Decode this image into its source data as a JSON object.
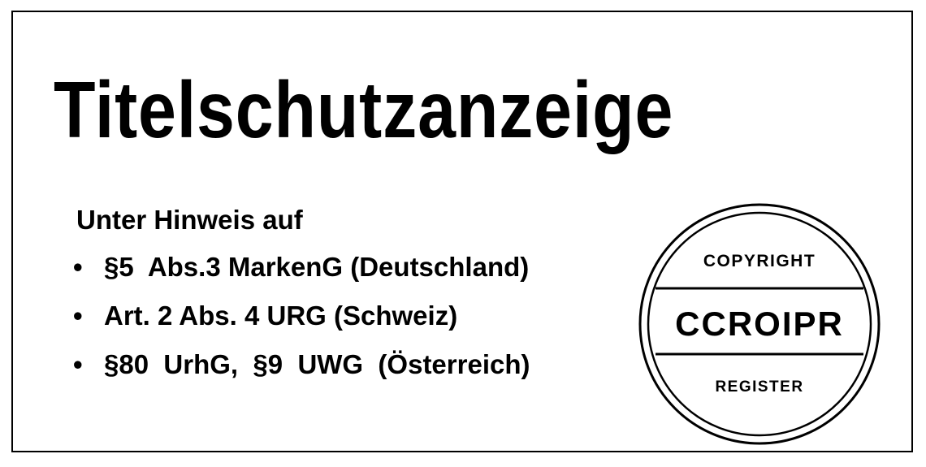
{
  "title": "Titelschutzanzeige",
  "intro": "Unter Hinweis auf",
  "laws": [
    "§5  Abs.3 MarkenG (Deutschland)",
    "Art. 2 Abs. 4 URG (Schweiz)",
    "§80  UrhG,  §9  UWG  (Österreich)"
  ],
  "bullet_symbol": "•",
  "seal": {
    "top_text": "COPYRIGHT",
    "center_text": "CCROIPR",
    "bottom_text": "REGISTER"
  },
  "colors": {
    "ink": "#000000",
    "paper": "#ffffff"
  }
}
